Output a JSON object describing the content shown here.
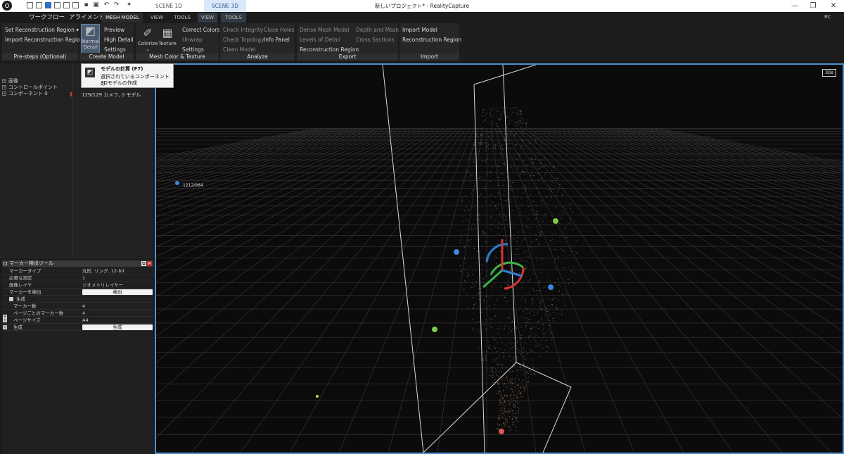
{
  "titlebar": {
    "window_title": "新しいプロジェクト* - RealityCapture",
    "scene_tabs": [
      "SCENE 1D",
      "SCENE 3D"
    ],
    "window_buttons": [
      "—",
      "❐",
      "✕"
    ]
  },
  "menubar": {
    "items": [
      "ワークフロー",
      "アライメント"
    ],
    "tabs": [
      "MESH MODEL",
      "VIEW",
      "TOOLS",
      "VIEW",
      "TOOLS"
    ],
    "rc": "RC"
  },
  "ribbon": {
    "prestep": {
      "label": "Pre-steps (Optional)",
      "set_region": "Set Reconstruction Region ▾",
      "import_region": "Import Reconstruction Region"
    },
    "create_model": {
      "label": "Create Model",
      "normal_detail_line1": "Normal",
      "normal_detail_line2": "Detail",
      "preview": "Preview",
      "high_detail": "High Detail",
      "settings": "Settings"
    },
    "mesh_color": {
      "label": "Mesh Color & Texture",
      "colorize": "Colorize",
      "texture": "Texture",
      "correct_colors": "Correct Colors",
      "unwrap": "Unwrap",
      "settings": "Settings"
    },
    "analyze": {
      "label": "Analyze",
      "check_integrity": "Check Integrity",
      "check_topology": "Check Topology",
      "clean_model": "Clean Model",
      "close_holes": "Close Holes",
      "info_panel": "Info Panel"
    },
    "export": {
      "label": "Export",
      "dense_mesh_model": "Dense Mesh Model",
      "levels_of_detail": "Levels of Detail",
      "reconstruction_region": "Reconstruction Region",
      "depth_and_mask": "Depth and Mask",
      "cross_sections": "Cross Sections"
    },
    "import": {
      "label": "Import",
      "import_model": "Import Model",
      "reconstruction_region": "Reconstruction Region"
    }
  },
  "tooltip": {
    "title": "モデルの計算 (F7)",
    "desc_line1": "選択されているコンポーネントの",
    "desc_line2": "3Dモデルの作成"
  },
  "tree": {
    "items": [
      "画像",
      "コントロールポイント",
      "コンポーネント 0"
    ],
    "info": "129/129 カメラ, 0 モデル"
  },
  "marker_panel": {
    "title": "マーカー検出ツール",
    "rows": [
      {
        "label": "マーカータイプ",
        "value": "丸形, リング, 12-bit"
      },
      {
        "label": "必要な測定",
        "value": "1"
      },
      {
        "label": "画像レイヤ",
        "value": "ジオメトリレイヤー"
      },
      {
        "label": "マーカーを検出",
        "button": "検出"
      }
    ],
    "section": "生成",
    "gen_rows": [
      {
        "label": "マーカー数",
        "value": "4"
      },
      {
        "label": "ページごとのマーカー数",
        "value": "4"
      },
      {
        "label": "ページサイズ",
        "value": "A4"
      },
      {
        "label": "生成",
        "button": "生成"
      }
    ]
  },
  "viewport": {
    "view_mode": "3Ds",
    "camera_label": "1212/984",
    "colors": {
      "grid": "#3a3a3a",
      "box": "#d9d9d9",
      "point_cloud": "#8a6a55",
      "gizmo_x": "#d8342f",
      "gizmo_y": "#39b54a",
      "gizmo_z": "#2b7fd6",
      "marker_green": "#7fc94a",
      "marker_blue": "#3c88e0",
      "marker_red": "#e25555"
    }
  }
}
